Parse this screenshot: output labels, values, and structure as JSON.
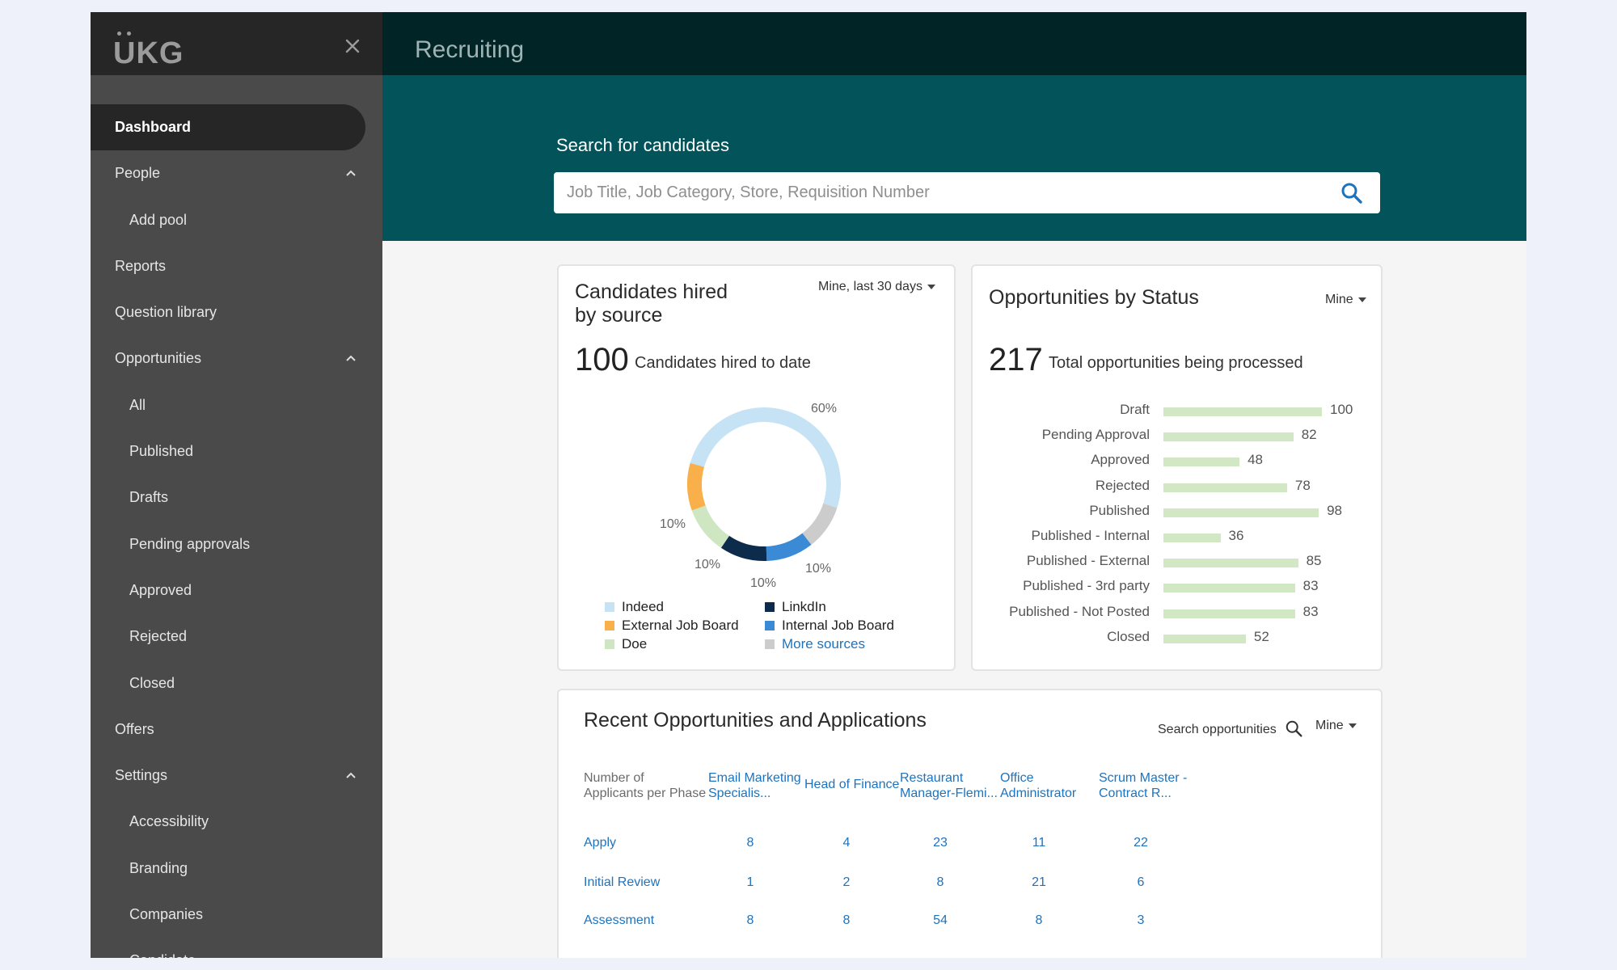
{
  "brand": {
    "logo_text": "UKG"
  },
  "sidebar": {
    "items": [
      {
        "label": "Dashboard",
        "level": 1,
        "active": true
      },
      {
        "label": "People",
        "level": 1,
        "expanded": true
      },
      {
        "label": "Add pool",
        "level": 2
      },
      {
        "label": "Reports",
        "level": 1
      },
      {
        "label": "Question library",
        "level": 1
      },
      {
        "label": "Opportunities",
        "level": 1,
        "expanded": true
      },
      {
        "label": "All",
        "level": 2
      },
      {
        "label": "Published",
        "level": 2
      },
      {
        "label": "Drafts",
        "level": 2
      },
      {
        "label": "Pending approvals",
        "level": 2
      },
      {
        "label": "Approved",
        "level": 2
      },
      {
        "label": "Rejected",
        "level": 2
      },
      {
        "label": "Closed",
        "level": 2
      },
      {
        "label": "Offers",
        "level": 1
      },
      {
        "label": "Settings",
        "level": 1,
        "expanded": true
      },
      {
        "label": "Accessibility",
        "level": 2
      },
      {
        "label": "Branding",
        "level": 2
      },
      {
        "label": "Companies",
        "level": 2
      },
      {
        "label": "Candidate...",
        "level": 2
      }
    ]
  },
  "header": {
    "title": "Recruiting"
  },
  "search": {
    "label": "Search for candidates",
    "placeholder": "Job Title, Job Category, Store, Requisition Number"
  },
  "hired_card": {
    "title_line1": "Candidates hired",
    "title_line2": "by source",
    "filter": "Mine, last 30 days",
    "total": "100",
    "total_caption": "Candidates hired to date",
    "percent_labels": {
      "indeed": "60%",
      "external": "10%",
      "doe": "10%",
      "linkedin": "10%",
      "internal": "10%"
    },
    "legend": {
      "indeed": "Indeed",
      "linkedin": "LinkdIn",
      "external": "External Job Board",
      "internal": "Internal Job Board",
      "doe": "Doe",
      "more": "More sources"
    }
  },
  "status_card": {
    "title": "Opportunities by Status",
    "filter": "Mine",
    "total": "217",
    "total_caption": "Total opportunities being processed"
  },
  "recent_card": {
    "title": "Recent Opportunities and Applications",
    "search_label": "Search opportunities",
    "filter": "Mine",
    "row_header_line1": "Number of",
    "row_header_line2": "Applicants per Phase",
    "columns": [
      {
        "line1": "Email Marketing",
        "line2": "Specialis..."
      },
      {
        "line1": "Head of Finance",
        "line2": ""
      },
      {
        "line1": "Restaurant",
        "line2": "Manager-Flemi..."
      },
      {
        "line1": "Office",
        "line2": "Administrator"
      },
      {
        "line1": "Scrum Master -",
        "line2": "Contract R..."
      }
    ],
    "rows": [
      {
        "phase": "Apply",
        "values": [
          "8",
          "4",
          "23",
          "11",
          "22"
        ]
      },
      {
        "phase": "Initial Review",
        "values": [
          "1",
          "2",
          "8",
          "21",
          "6"
        ]
      },
      {
        "phase": "Assessment",
        "values": [
          "8",
          "8",
          "54",
          "8",
          "3"
        ]
      }
    ]
  },
  "chart_data": [
    {
      "type": "pie",
      "variant": "donut",
      "title": "Candidates hired by source",
      "categories": [
        "Indeed",
        "LinkdIn",
        "External Job Board",
        "Internal Job Board",
        "Doe",
        "More sources"
      ],
      "values": [
        60,
        10,
        10,
        10,
        10,
        0
      ],
      "value_labels": [
        "60%",
        "10%",
        "10%",
        "10%",
        "10%",
        ""
      ],
      "colors": [
        "#c6e3f5",
        "#0d2b4a",
        "#f9b04a",
        "#3a8ad6",
        "#cfe6c2",
        "#cccccc"
      ],
      "legend": "bottom"
    },
    {
      "type": "bar",
      "orientation": "horizontal",
      "title": "Opportunities by Status",
      "categories": [
        "Draft",
        "Pending Approval",
        "Approved",
        "Rejected",
        "Published",
        "Published - Internal",
        "Published - External",
        "Published - 3rd party",
        "Published - Not Posted",
        "Closed"
      ],
      "values": [
        100,
        82,
        48,
        78,
        98,
        36,
        85,
        83,
        83,
        52
      ],
      "xlim": [
        0,
        100
      ],
      "color": "#d2e8c5",
      "grid": false
    }
  ]
}
